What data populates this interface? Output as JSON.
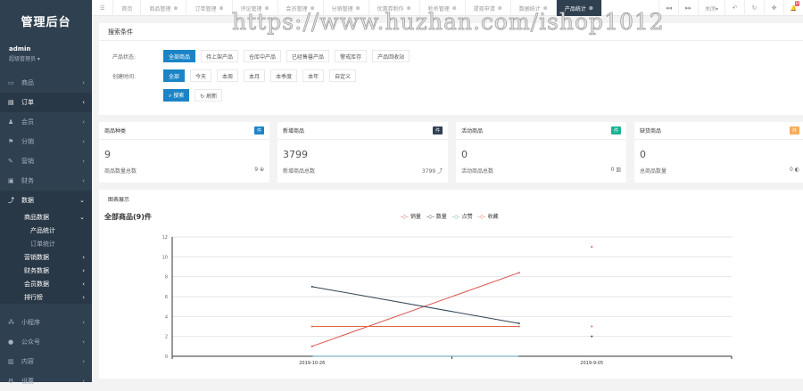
{
  "sidebar": {
    "logo": "管理后台",
    "user": "admin",
    "role": "超级管理员 ▾",
    "items": [
      {
        "icon": "▭",
        "label": "商品"
      },
      {
        "icon": "▤",
        "label": "订单"
      },
      {
        "icon": "♟",
        "label": "会员"
      },
      {
        "icon": "⚑",
        "label": "分销"
      },
      {
        "icon": "✎",
        "label": "营销"
      },
      {
        "icon": "▣",
        "label": "财务"
      },
      {
        "icon": "⤴",
        "label": "数据"
      }
    ],
    "data_sub": {
      "label": "商品数据",
      "children": [
        "产品统计",
        "订单统计"
      ]
    },
    "data_more": [
      "营销数据",
      "财务数据",
      "会员数据",
      "排行榜"
    ],
    "bottom": [
      {
        "icon": "⁂",
        "label": "小程序"
      },
      {
        "icon": "●",
        "label": "公众号"
      },
      {
        "icon": "▥",
        "label": "内容"
      },
      {
        "icon": "⚙",
        "label": "设置"
      }
    ]
  },
  "topbar": {
    "menu_icon": "☰",
    "tabs": [
      "首页",
      "商品管理",
      "订单管理",
      "评论管理",
      "会员管理",
      "分销管理",
      "优惠券制作",
      "秒杀管理",
      "提现申请",
      "数据统计",
      "产品统计"
    ],
    "right": {
      "prev": "◂◂",
      "next": "▸▸",
      "close_label": "关闭▾",
      "back": "↶",
      "refresh": "↻",
      "fullscreen": "✥",
      "bell": "🔔",
      "badge": "0"
    }
  },
  "watermark": "https://www.huzhan.com/ishop1012",
  "search": {
    "title": "搜索条件",
    "status_label": "产品状态:",
    "status_options": [
      "全部商品",
      "待上架产品",
      "仓库中产品",
      "已经售罄产品",
      "警戒库存",
      "产品回收站"
    ],
    "time_label": "创建时间:",
    "time_options": [
      "全部",
      "今天",
      "本周",
      "本月",
      "本季度",
      "本年",
      "自定义"
    ],
    "search_btn": "⌕ 搜索",
    "refresh_btn": "↻ 刷新"
  },
  "cards": [
    {
      "title": "商品种类",
      "tag": "件",
      "color": "#1c84c6",
      "value": "9",
      "footer": "商品数量总数",
      "fv": "9 ⊕"
    },
    {
      "title": "新增商品",
      "tag": "件",
      "color": "#2f4050",
      "value": "3799",
      "footer": "新增商品总数",
      "fv": "3799 ⤴"
    },
    {
      "title": "活动商品",
      "tag": "件",
      "color": "#1ab394",
      "value": "0",
      "footer": "活动商品总数",
      "fv": "0 ▥"
    },
    {
      "title": "缺货商品",
      "tag": "件",
      "color": "#f8ac59",
      "value": "0",
      "footer": "总商品数量",
      "fv": "0 ◐"
    }
  ],
  "chart_panel": {
    "title": "图表展示"
  },
  "chart_data": {
    "type": "line",
    "title": "全部商品(9)件",
    "categories": [
      "2019-10-26",
      "2019-9-05"
    ],
    "ylim": [
      0,
      12
    ],
    "yticks": [
      0,
      2,
      4,
      6,
      8,
      10,
      12
    ],
    "legend_position": "top-center",
    "series": [
      {
        "name": "销量",
        "color": "#d9534f",
        "points": [
          [
            0,
            1
          ],
          [
            0.74,
            8.4
          ]
        ],
        "extra": [
          1,
          11
        ]
      },
      {
        "name": "数量",
        "color": "#2f4554",
        "points": [
          [
            0,
            7
          ],
          [
            0.74,
            3.3
          ]
        ],
        "extra": [
          1,
          2
        ]
      },
      {
        "name": "点赞",
        "color": "#61a0a8",
        "points": [
          [
            0,
            0
          ],
          [
            0.74,
            0
          ]
        ],
        "extra": [
          1,
          0
        ]
      },
      {
        "name": "收藏",
        "color": "#e0663f",
        "points": [
          [
            0,
            3
          ],
          [
            0.74,
            3
          ]
        ],
        "extra": [
          1,
          3
        ]
      }
    ]
  }
}
